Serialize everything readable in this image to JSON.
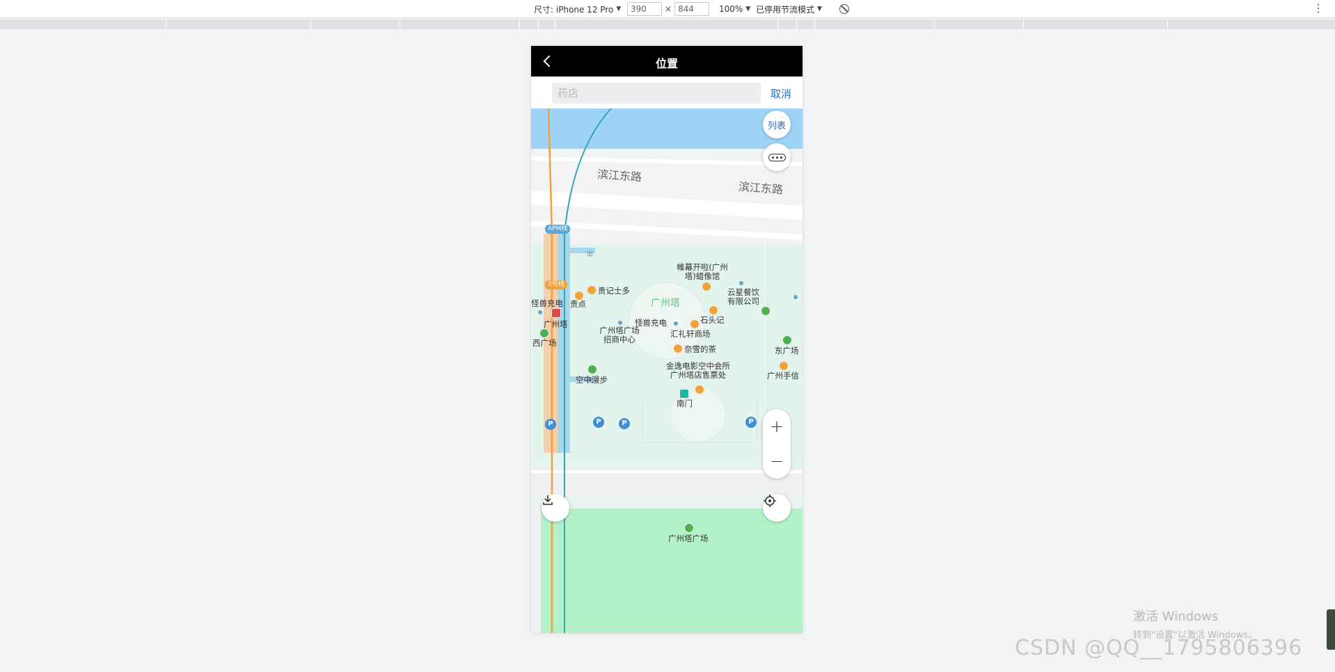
{
  "devtools": {
    "device_label": "尺寸: iPhone 12 Pro",
    "width_value": "390",
    "height_value": "844",
    "times_sign": "×",
    "zoom": "100%",
    "throttle": "已停用节流模式"
  },
  "page": {
    "title": "位置",
    "search": {
      "placeholder": "药店",
      "value": ""
    },
    "cancel_label": "取消"
  },
  "map": {
    "road_labels": [
      "滨江东路",
      "滨江东路"
    ],
    "metro_labels": [
      "APM线",
      "3号线"
    ],
    "pois": [
      "帷幕开啦(广州塔)蜡像馆",
      "云星餐饮有限公司",
      "贵记士多",
      "贵点",
      "广州塔",
      "石头记",
      "怪兽充电",
      "怪兽充电",
      "广州塔",
      "汇礼轩商场",
      "广州塔广场招商中心",
      "奈雪的茶",
      "西广场",
      "东广场",
      "金逸电影空中会所广州塔店售票处",
      "广州手信",
      "空中漫步",
      "南门",
      "广州塔广场"
    ],
    "exit_marker": "出",
    "parking_marker": "P",
    "list_button": "列表",
    "zoom_in": "+",
    "zoom_out": "−",
    "icons": [
      "more-dots-icon",
      "download-icon",
      "locate-icon",
      "back-chevron-icon"
    ]
  },
  "overlay": {
    "windows_activate_title": "激活 Windows",
    "windows_activate_sub": "转到\"设置\"以激活 Windows。",
    "csdn_watermark": "CSDN @QQ__1795806396"
  },
  "colors": {
    "water": "#9dd3f7",
    "park": "#b3f2c8",
    "link": "#2a6fc8"
  }
}
